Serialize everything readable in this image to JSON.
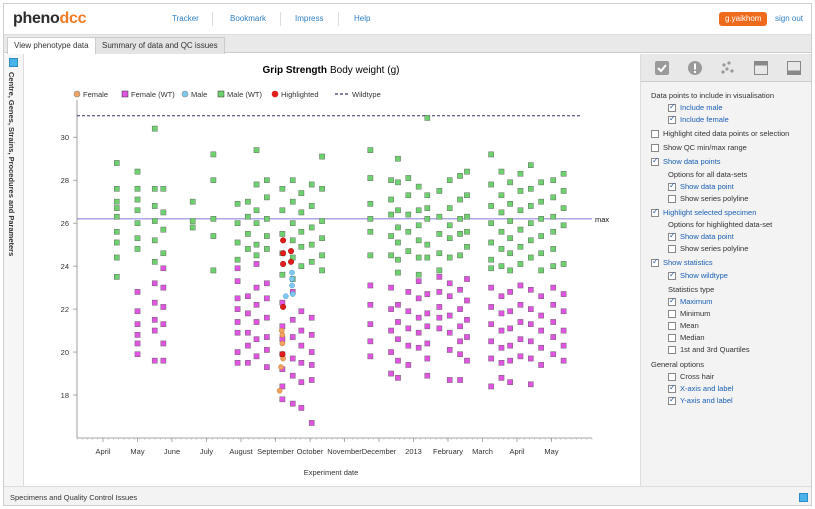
{
  "app": {
    "logo_part1": "pheno",
    "logo_part2": "dcc"
  },
  "nav": [
    "Tracker",
    "Bookmark",
    "Impress",
    "Help"
  ],
  "user": {
    "name": "g.yaikhom",
    "signout": "sign out"
  },
  "tabs": [
    "View phenotype data",
    "Summary of data and QC issues"
  ],
  "side_label": "Centre, Genes, Strains, Procedures and Parameters",
  "bottom_label": "Specimens and Quality Control Issues",
  "chart_data": {
    "type": "scatter",
    "title": "Grip Strength",
    "subtitle": "Body weight (g)",
    "xlabel": "Experiment date",
    "x_ticks": [
      "April",
      "May",
      "June",
      "July",
      "August",
      "September",
      "October",
      "November",
      "December",
      "2013",
      "February",
      "March",
      "April",
      "May"
    ],
    "y_ticks": [
      18,
      20,
      22,
      24,
      26,
      28,
      30
    ],
    "ylim": [
      16,
      31.5
    ],
    "max_label": "max",
    "max_value": 26.2,
    "wildtype_value": 31.0,
    "legend": [
      {
        "label": "Female",
        "color": "#f2a35f",
        "shape": "circle"
      },
      {
        "label": "Female (WT)",
        "color": "#e055e0",
        "shape": "square"
      },
      {
        "label": "Male",
        "color": "#7ec8ef",
        "shape": "circle"
      },
      {
        "label": "Male (WT)",
        "color": "#6ed06e",
        "shape": "square"
      },
      {
        "label": "Highlighted",
        "color": "#e21b1b",
        "shape": "circle"
      },
      {
        "label": "Wildtype",
        "color": "#333366",
        "shape": "dash"
      }
    ],
    "groups": [
      {
        "x": 0.4,
        "male_wt": [
          28.8,
          27.6,
          27.0,
          26.7,
          26.3,
          25.6,
          25.1,
          24.4,
          23.5
        ],
        "female_wt": []
      },
      {
        "x": 1.0,
        "male_wt": [
          28.4,
          27.6,
          27.1,
          26.6,
          26.0,
          25.3,
          24.8
        ],
        "female_wt": [
          22.8,
          21.9,
          21.3,
          20.8,
          20.4,
          19.9
        ]
      },
      {
        "x": 1.5,
        "male_wt": [
          30.4,
          27.6,
          26.8,
          26.1,
          25.2,
          24.2
        ],
        "female_wt": [
          23.2,
          22.3,
          21.5,
          21.0,
          19.6
        ]
      },
      {
        "x": 1.75,
        "male_wt": [
          27.6,
          26.5,
          25.7,
          24.6
        ],
        "female_wt": [
          23.9,
          23.0,
          22.1,
          21.3,
          20.4,
          19.6
        ]
      },
      {
        "x": 2.6,
        "male_wt": [
          27.0,
          26.1,
          25.8
        ],
        "female_wt": []
      },
      {
        "x": 3.2,
        "male_wt": [
          29.2,
          28.0,
          26.2,
          25.4,
          23.8
        ],
        "female_wt": []
      },
      {
        "x": 3.9,
        "male_wt": [
          26.9,
          26.0,
          25.1,
          24.3
        ],
        "female_wt": [
          23.9,
          23.3,
          22.5,
          22.0,
          21.4,
          20.9,
          20.0,
          19.5
        ]
      },
      {
        "x": 4.2,
        "male_wt": [
          27.0,
          26.3,
          25.5,
          24.8
        ],
        "female_wt": [
          22.6,
          21.8,
          20.9,
          20.3,
          19.5
        ]
      },
      {
        "x": 4.45,
        "male_wt": [
          29.4,
          27.8,
          26.6,
          26.0,
          25.0,
          24.5
        ],
        "female_wt": [
          24.1,
          23.0,
          22.2,
          21.4,
          20.6,
          19.8
        ]
      },
      {
        "x": 4.75,
        "male_wt": [
          28.0,
          27.2,
          26.2,
          25.4,
          24.8
        ],
        "female_wt": [
          23.2,
          22.5,
          21.6,
          20.7,
          20.1,
          19.3
        ]
      },
      {
        "x": 5.2,
        "male_wt": [
          27.6,
          26.6,
          25.5,
          24.6,
          23.6
        ],
        "female_wt": [
          22.3,
          21.2,
          20.6,
          19.9,
          19.2,
          18.4,
          17.8
        ]
      },
      {
        "x": 5.5,
        "male_wt": [
          28.0,
          27.0,
          26.0,
          25.2,
          24.4,
          23.4
        ],
        "female_wt": [
          22.8,
          21.5,
          20.7,
          19.7,
          18.9,
          17.6
        ]
      },
      {
        "x": 5.75,
        "male_wt": [
          27.4,
          26.5,
          25.6,
          24.9,
          24.0
        ],
        "female_wt": [
          21.9,
          21.0,
          20.3,
          19.5,
          18.6,
          17.4
        ]
      },
      {
        "x": 6.05,
        "male_wt": [
          27.8,
          26.8,
          25.8,
          25.0,
          24.2
        ],
        "female_wt": [
          21.6,
          20.8,
          20.0,
          19.4,
          18.7,
          16.7
        ]
      },
      {
        "x": 6.35,
        "male_wt": [
          29.1,
          27.6,
          26.1,
          25.3,
          24.5,
          23.8
        ],
        "female_wt": []
      },
      {
        "x": 7.75,
        "male_wt": [
          29.4,
          28.1,
          26.9,
          26.2,
          25.6,
          24.5
        ],
        "female_wt": [
          23.1,
          22.2,
          21.3,
          20.5,
          19.8
        ]
      },
      {
        "x": 8.35,
        "male_wt": [
          28.0,
          27.1,
          26.4,
          25.4,
          24.5
        ],
        "female_wt": [
          23.0,
          22.0,
          21.0,
          20.0,
          19.0
        ]
      },
      {
        "x": 8.55,
        "male_wt": [
          29.0,
          27.9,
          26.6,
          25.8,
          25.1,
          24.3,
          23.7
        ],
        "female_wt": [
          22.2,
          21.4,
          20.6,
          19.6,
          18.8
        ]
      },
      {
        "x": 8.85,
        "male_wt": [
          28.1,
          27.3,
          26.4,
          25.6,
          24.7
        ],
        "female_wt": [
          22.8,
          21.9,
          21.1,
          20.3,
          19.4
        ]
      },
      {
        "x": 9.15,
        "male_wt": [
          27.7,
          26.6,
          25.9,
          25.2,
          24.4,
          23.6
        ],
        "female_wt": [
          23.3,
          22.5,
          21.6,
          20.9,
          20.2
        ]
      },
      {
        "x": 9.4,
        "male_wt": [
          30.9,
          27.3,
          26.7,
          26.2,
          25.0,
          24.4
        ],
        "female_wt": [
          22.7,
          21.8,
          21.2,
          20.4,
          19.7,
          18.9
        ]
      },
      {
        "x": 9.75,
        "male_wt": [
          27.5,
          26.3,
          25.5,
          24.6,
          23.8
        ],
        "female_wt": [
          23.5,
          22.8,
          22.1,
          21.6,
          21.1
        ]
      },
      {
        "x": 10.05,
        "male_wt": [
          28.0,
          26.7,
          25.9,
          25.3,
          24.4
        ],
        "female_wt": [
          23.2,
          22.6,
          21.7,
          20.9,
          20.1,
          18.7
        ]
      },
      {
        "x": 10.35,
        "male_wt": [
          28.2,
          27.1,
          26.2,
          25.5,
          24.5
        ],
        "female_wt": [
          22.9,
          22.0,
          21.2,
          20.5,
          19.9,
          18.7
        ]
      },
      {
        "x": 10.55,
        "male_wt": [
          28.4,
          27.3,
          26.3,
          25.6,
          24.9
        ],
        "female_wt": [
          23.4,
          22.4,
          21.5,
          20.7,
          19.6
        ]
      },
      {
        "x": 11.25,
        "male_wt": [
          29.2,
          27.8,
          26.8,
          26.0,
          25.1,
          24.3,
          23.9
        ],
        "female_wt": [
          23.0,
          22.1,
          21.3,
          20.5,
          19.7,
          18.4
        ]
      },
      {
        "x": 11.55,
        "male_wt": [
          28.4,
          27.3,
          26.5,
          25.6,
          24.8,
          24.0
        ],
        "female_wt": [
          22.6,
          21.8,
          21.0,
          20.2,
          19.5,
          18.8
        ]
      },
      {
        "x": 11.8,
        "male_wt": [
          27.9,
          26.9,
          26.1,
          25.3,
          24.6,
          23.8
        ],
        "female_wt": [
          22.8,
          21.9,
          21.1,
          20.3,
          19.6,
          18.6
        ]
      },
      {
        "x": 12.1,
        "male_wt": [
          28.3,
          27.5,
          26.6,
          25.7,
          24.9,
          24.1
        ],
        "female_wt": [
          23.1,
          22.2,
          21.4,
          20.6,
          19.8
        ]
      },
      {
        "x": 12.4,
        "male_wt": [
          28.7,
          27.6,
          26.8,
          26.0,
          25.2,
          24.4
        ],
        "female_wt": [
          22.9,
          22.0,
          21.3,
          20.5,
          19.7,
          18.5
        ]
      },
      {
        "x": 12.7,
        "male_wt": [
          27.9,
          27.0,
          26.2,
          25.4,
          24.6,
          23.8
        ],
        "female_wt": [
          22.6,
          21.7,
          21.0,
          20.2,
          19.4
        ]
      },
      {
        "x": 13.05,
        "male_wt": [
          28.0,
          27.2,
          26.3,
          25.6,
          24.8,
          24.0
        ],
        "female_wt": [
          23.0,
          22.2,
          21.4,
          20.7,
          19.9
        ]
      },
      {
        "x": 13.35,
        "male_wt": [
          28.3,
          27.5,
          26.7,
          25.9,
          24.1
        ],
        "female_wt": [
          22.7,
          21.9,
          21.0,
          20.3,
          19.6
        ]
      }
    ],
    "highlighted": [
      {
        "x": 5.22,
        "y": 25.2
      },
      {
        "x": 5.22,
        "y": 24.6
      },
      {
        "x": 5.45,
        "y": 24.7
      },
      {
        "x": 5.45,
        "y": 24.2
      },
      {
        "x": 5.22,
        "y": 24.1
      },
      {
        "x": 5.22,
        "y": 22.1
      },
      {
        "x": 5.2,
        "y": 19.9
      }
    ],
    "male": [
      {
        "x": 5.48,
        "y": 23.7
      },
      {
        "x": 5.48,
        "y": 23.4
      },
      {
        "x": 5.48,
        "y": 23.1
      },
      {
        "x": 5.5,
        "y": 22.7
      },
      {
        "x": 5.3,
        "y": 22.6
      }
    ],
    "female": [
      {
        "x": 5.18,
        "y": 21.0
      },
      {
        "x": 5.2,
        "y": 20.8
      },
      {
        "x": 5.2,
        "y": 20.4
      },
      {
        "x": 5.22,
        "y": 19.7
      },
      {
        "x": 5.16,
        "y": 19.3
      },
      {
        "x": 5.12,
        "y": 18.2
      }
    ]
  },
  "panel": {
    "section1": "Data points to include in visualisation",
    "include_male": "Include male",
    "include_female": "Include female",
    "highlight_cited": "Highlight cited data points or selection",
    "show_qc": "Show QC min/max range",
    "show_data_points": "Show data points",
    "options_all": "Options for all data-sets",
    "show_data_point": "Show data point",
    "show_series_polyline": "Show series polyline",
    "highlight_selected": "Highlight selected specimen",
    "options_highlighted": "Options for highlighted data-set",
    "show_data_point2": "Show data point",
    "show_series_polyline2": "Show series polyline",
    "show_statistics": "Show statistics",
    "show_wildtype": "Show wildtype",
    "statistics_type": "Statistics type",
    "maximum": "Maximum",
    "minimum": "Minimum",
    "mean": "Mean",
    "median": "Median",
    "quartiles": "1st and 3rd Quartiles",
    "general_options": "General options",
    "cross_hair": "Cross hair",
    "x_axis": "X-axis and label",
    "y_axis": "Y-axis and label"
  }
}
